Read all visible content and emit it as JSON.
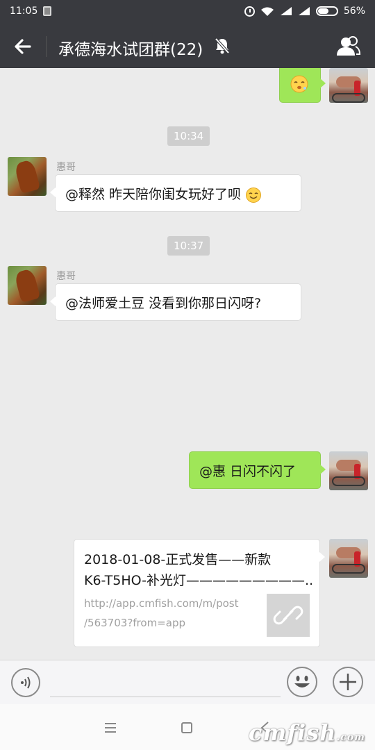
{
  "status_bar": {
    "time": "11:05",
    "battery_percent": "56%",
    "battery_level": 0.56
  },
  "header": {
    "title": "承德海水试团群(22)",
    "back_icon": "arrow-left-icon",
    "mute_icon": "bell-off-icon",
    "members_icon": "group-members-icon"
  },
  "messages": {
    "m0_emoji": "sleepy-face-emoji",
    "t1": "10:34",
    "m1_sender": "惠哥",
    "m1_text": "@释然 昨天陪你闺女玩好了呗",
    "m1_emoji": "smile-emoji",
    "t2": "10:37",
    "m2_sender": "惠哥",
    "m2_text": "@法师爱土豆 没看到你那日闪呀?",
    "m3_text": "@惠 日闪不闪了",
    "link": {
      "title_line1": "2018-01-08-正式发售——新款",
      "title_line2": "K6-T5HO-补光灯—————————...",
      "url_line1": "http://app.cmfish.com/m/post",
      "url_line2": "/563703?from=app",
      "thumb_icon": "link-icon"
    }
  },
  "input_bar": {
    "voice_icon": "voice-icon",
    "emoji_icon": "emoji-icon",
    "plus_icon": "plus-icon",
    "placeholder": ""
  },
  "nav_bar": {
    "menu_icon": "menu-icon",
    "home_icon": "square-home-icon",
    "back_icon": "chevron-left-icon",
    "watermark_main": "cmfish",
    "watermark_suffix": ".com"
  },
  "colors": {
    "header_bg": "#393a3f",
    "chat_bg": "#ebebeb",
    "green_bubble": "#9fe658",
    "time_pill": "#cecece"
  }
}
